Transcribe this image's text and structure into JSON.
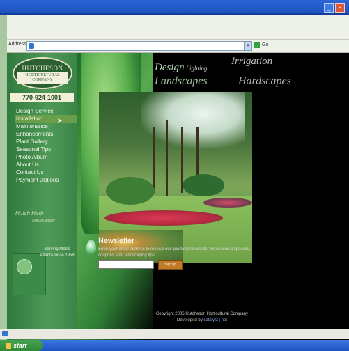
{
  "browser": {
    "address_label": "Address",
    "go_label": "Go"
  },
  "logo": {
    "line1": "HUTCHESON",
    "line2": "HORTICULTURAL",
    "line3": "COMPANY"
  },
  "phone": "770-924-1001",
  "nav": [
    {
      "label": "Design Service"
    },
    {
      "label": "Installation"
    },
    {
      "label": "Maintenance"
    },
    {
      "label": "Enhancements"
    },
    {
      "label": "Plant Gallery"
    },
    {
      "label": "Seasonal Tips"
    },
    {
      "label": "Photo Album"
    },
    {
      "label": "About Us"
    },
    {
      "label": "Contact Us"
    },
    {
      "label": "Payment Options"
    }
  ],
  "sidebar_promo": {
    "hutch_line1": "Hutch Herb",
    "hutch_line2": "Newsletter",
    "serving_text": "Serving Metro Atlanta since 1958"
  },
  "banner": {
    "irrigation": "Irrigation",
    "design": "Design",
    "lighting": "Lighting",
    "landscapes": "Landscapes",
    "hardscapes": "Hardscapes"
  },
  "newsletter": {
    "title": "Newsletter",
    "text": "Enter your email address to receive our quarterly newsletter for seasonal specials, coupons, and landscaping tips.",
    "button": "Sign up"
  },
  "footer": {
    "copyright": "Copyright 2005 Hutcheson Horticultural Company",
    "developed_by": "Developed by",
    "developer": "catalyst | net"
  },
  "taskbar": {
    "start": "start"
  }
}
